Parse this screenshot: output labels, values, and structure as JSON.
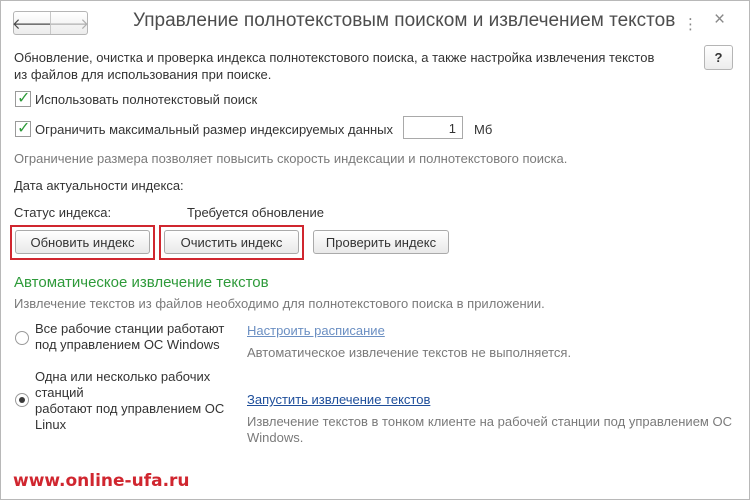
{
  "window": {
    "title": "Управление полнотекстовым поиском и извлечением текстов",
    "back_glyph": "🡐",
    "forward_glyph": "🡒",
    "menu_glyph": "⋮",
    "close_glyph": "×",
    "help_label": "?"
  },
  "intro": {
    "line1": "Обновление, очистка и проверка индекса полнотекстового поиска, а также настройка извлечения текстов",
    "line2": "из файлов для использования при поиске."
  },
  "options": {
    "use_fulltext_label": "Использовать полнотекстовый поиск",
    "use_fulltext_checked": true,
    "limit_size_label": "Ограничить максимальный размер индексируемых данных",
    "limit_size_checked": true,
    "limit_size_value": "1",
    "limit_size_unit": "Мб",
    "limit_hint": "Ограничение размера позволяет повысить скорость индексации и полнотекстового поиска."
  },
  "index": {
    "date_label": "Дата актуальности индекса:",
    "status_label": "Статус индекса:",
    "status_value": "Требуется обновление",
    "update_button": "Обновить индекс",
    "clear_button": "Очистить индекс",
    "check_button": "Проверить индекс"
  },
  "extraction": {
    "title": "Автоматическое извлечение текстов",
    "description": "Извлечение текстов из файлов необходимо для полнотекстового поиска в приложении.",
    "option1_line1": "Все рабочие станции работают",
    "option1_line2": "под управлением ОС Windows",
    "option1_selected": false,
    "option1_link": "Настроить расписание",
    "option1_status": "Автоматическое извлечение текстов не выполняется.",
    "option2_line1": "Одна или несколько рабочих",
    "option2_line2": "станций",
    "option2_line3": "работают под управлением ОС",
    "option2_line4": "Linux",
    "option2_selected": true,
    "option2_link": "Запустить извлечение текстов",
    "option2_status_line1": "Извлечение текстов в тонком клиенте на рабочей станции под управлением ОС",
    "option2_status_line2": "Windows."
  },
  "watermark": "www.online-ufa.ru",
  "colors": {
    "accent_green": "#2e9a3a",
    "highlight_red": "#d0262f",
    "link_blue": "#1e4e9a"
  }
}
